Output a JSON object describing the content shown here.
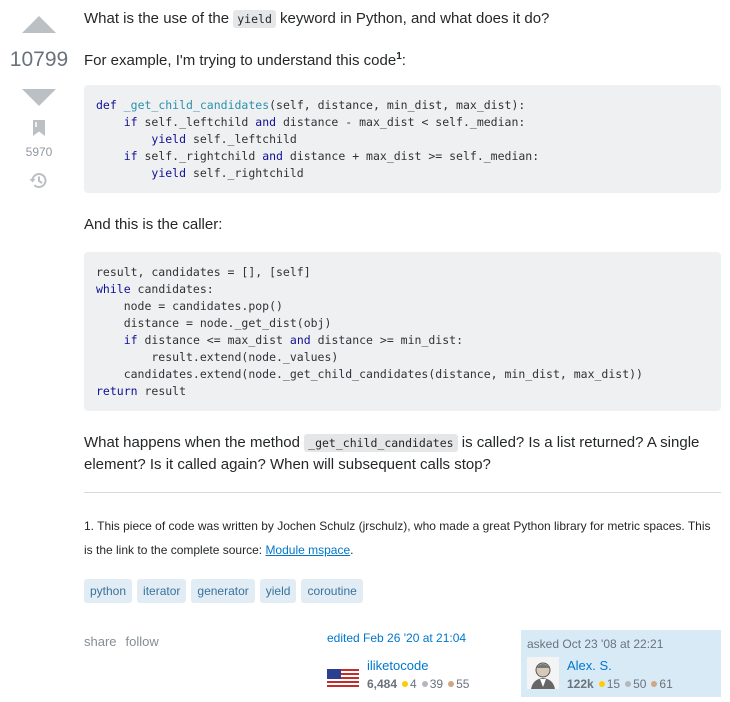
{
  "question": {
    "p1_before": "What is the use of the ",
    "p1_code": "yield",
    "p1_after": " keyword in Python, and what does it do?",
    "p2_text": "For example, I'm trying to understand this code",
    "p2_sup": "1",
    "p2_after": ":",
    "p3_text": "And this is the caller:",
    "p4_before": "What happens when the method ",
    "p4_code": "_get_child_candidates",
    "p4_after": " is called? Is a list returned? A single element? Is it called again? When will subsequent calls stop?",
    "footnote_text": "1. This piece of code was written by Jochen Schulz (jrschulz), who made a great Python library for metric spaces. This is the link to the complete source: ",
    "footnote_link": "Module mspace",
    "footnote_end": "."
  },
  "code1": {
    "l1_kw": "def",
    "l1_fn": "_get_child_candidates",
    "l1_rest": "(self, distance, min_dist, max_dist):",
    "l2_kw": "if",
    "l2_a": " self._leftchild ",
    "l2_kw2": "and",
    "l2_b": " distance - max_dist < self._median:",
    "l3_kw": "yield",
    "l3_rest": " self._leftchild",
    "l4_kw": "if",
    "l4_a": " self._rightchild ",
    "l4_kw2": "and",
    "l4_b": " distance + max_dist >= self._median:",
    "l5_kw": "yield",
    "l5_rest": " self._rightchild"
  },
  "code2": {
    "l1": "result, candidates = [], [self]",
    "l2_kw": "while",
    "l2_rest": " candidates:",
    "l3": "    node = candidates.pop()",
    "l4": "    distance = node._get_dist(obj)",
    "l5_kw": "if",
    "l5_a": " distance <= max_dist ",
    "l5_kw2": "and",
    "l5_b": " distance >= min_dist:",
    "l6": "        result.extend(node._values)",
    "l7": "    candidates.extend(node._get_child_candidates(distance, min_dist, max_dist))",
    "l8_kw": "return",
    "l8_rest": " result"
  },
  "votes": {
    "score": "10799",
    "bookmarks": "5970"
  },
  "tags": [
    "python",
    "iterator",
    "generator",
    "yield",
    "coroutine"
  ],
  "menu": {
    "share": "share",
    "follow": "follow"
  },
  "editor": {
    "action": "edited Feb 26 '20 at 21:04",
    "name": "iliketocode",
    "rep": "6,484",
    "gold": "4",
    "silver": "39",
    "bronze": "55"
  },
  "owner": {
    "action": "asked Oct 23 '08 at 22:21",
    "name": "Alex. S.",
    "rep": "122k",
    "gold": "15",
    "silver": "50",
    "bronze": "61"
  },
  "colors": {
    "vote_arrow": "#bbc0c4",
    "tag_bg": "#e1ecf4",
    "tag_text": "#39739d",
    "link": "#0077cc",
    "owner_bg": "#d9eaf7"
  }
}
